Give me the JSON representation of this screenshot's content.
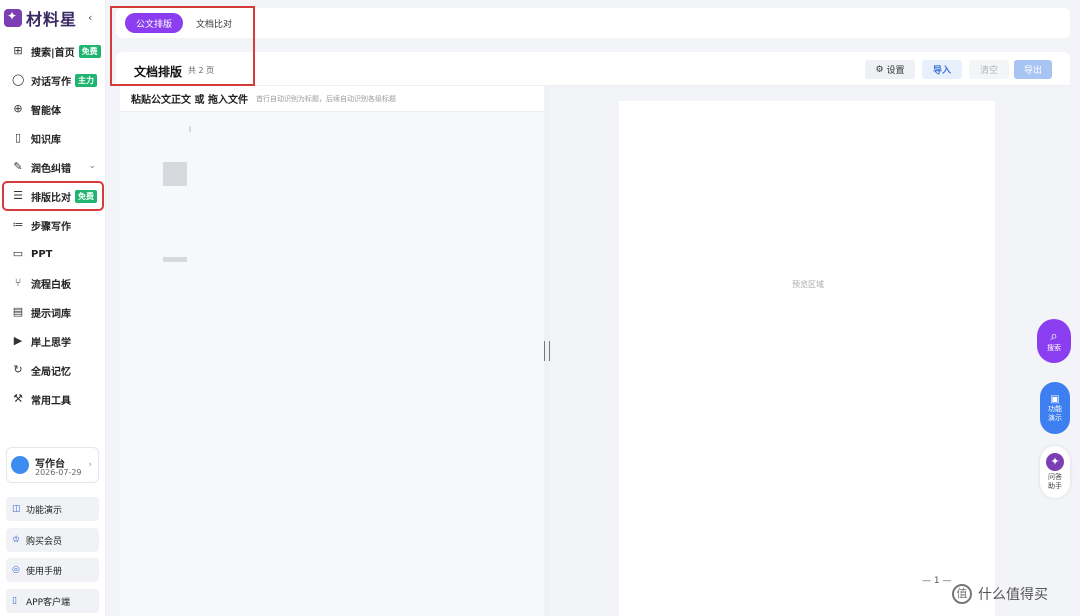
{
  "app": {
    "brand": "材料星",
    "collapse_icon": "‹"
  },
  "sidebar": {
    "items": [
      {
        "icon": "grid-icon",
        "label": "搜索|首页",
        "badge": "免费"
      },
      {
        "icon": "chat-icon",
        "label": "对话写作",
        "badge": "主力"
      },
      {
        "icon": "agent-icon",
        "label": "智能体",
        "badge": ""
      },
      {
        "icon": "book-icon",
        "label": "知识库",
        "badge": ""
      },
      {
        "icon": "pen-icon",
        "label": "润色纠错",
        "badge": ""
      },
      {
        "icon": "menu-icon",
        "label": "排版比对",
        "badge": "免费"
      },
      {
        "icon": "list-icon",
        "label": "步骤写作",
        "badge": ""
      },
      {
        "icon": "ppt-icon",
        "label": "PPT",
        "badge": ""
      },
      {
        "icon": "flow-icon",
        "label": "流程白板",
        "badge": ""
      },
      {
        "icon": "doc-icon",
        "label": "提示词库",
        "badge": ""
      },
      {
        "icon": "play-icon",
        "label": "岸上思学",
        "badge": ""
      },
      {
        "icon": "memory-icon",
        "label": "全局记忆",
        "badge": ""
      },
      {
        "icon": "wrench-icon",
        "label": "常用工具",
        "badge": ""
      }
    ],
    "user": {
      "name": "写作台",
      "date": "2026-07-29"
    },
    "bottom_buttons": [
      "功能演示",
      "购买会员",
      "使用手册",
      "APP客户端"
    ]
  },
  "tabs": {
    "active": "公文排版",
    "other": "文档比对"
  },
  "header": {
    "title": "文档排版",
    "count": "共 2 页",
    "settings": "设置",
    "import": "导入",
    "clear": "清空",
    "export": "导出"
  },
  "editor": {
    "title": "粘贴公文正文 或 拖入文件",
    "hint": "首行自动识别为标题，后续自动识别各级标题"
  },
  "preview": {
    "placeholder": "预览区域",
    "page_number": "— 1 —"
  },
  "fab": {
    "search": "搜索",
    "demo": "功能演示",
    "qa": "问答助手"
  },
  "watermark": {
    "text": "什么值得买",
    "icon": "值"
  },
  "colors": {
    "accent": "#8b3df0",
    "blue": "#3d7ff0",
    "badge_green": "#1fb46f",
    "highlight_red": "#d63b3b"
  }
}
